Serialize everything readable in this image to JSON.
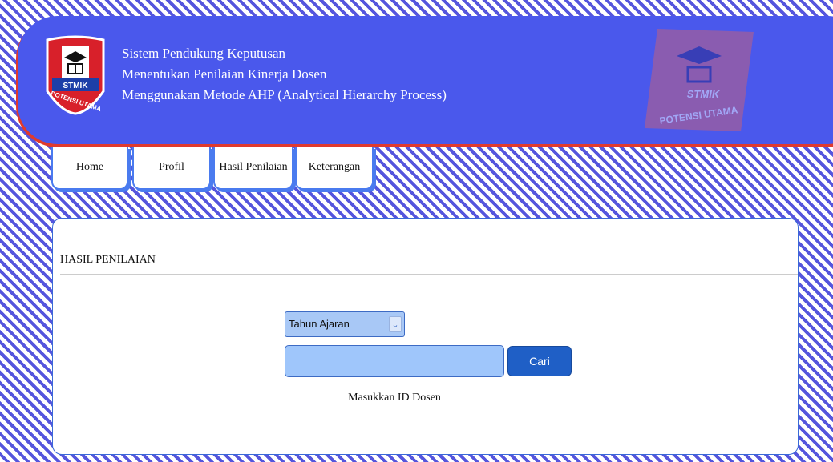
{
  "header": {
    "line1": "Sistem Pendukung Keputusan",
    "line2": "Menentukan Penilaian Kinerja Dosen",
    "line3": "Menggunakan Metode AHP (Analytical Hierarchy Process)",
    "logo_top_text": "STMIK",
    "logo_bottom_text": "POTENSI UTAMA",
    "logo_icon": "graduation-cap-book-icon"
  },
  "nav": {
    "items": [
      {
        "label": "Home"
      },
      {
        "label": "Profil"
      },
      {
        "label": "Hasil Penilaian"
      },
      {
        "label": "Keterangan"
      }
    ]
  },
  "panel": {
    "title": "HASIL PENILAIAN",
    "select_value": "Tahun Ajaran",
    "input_value": "",
    "search_button": "Cari",
    "hint": "Masukkan ID Dosen"
  },
  "colors": {
    "header_blue": "#4a58ec",
    "header_red": "#e03a2e",
    "button_blue": "#1f5fc6",
    "input_blue": "#9fc6fb"
  }
}
